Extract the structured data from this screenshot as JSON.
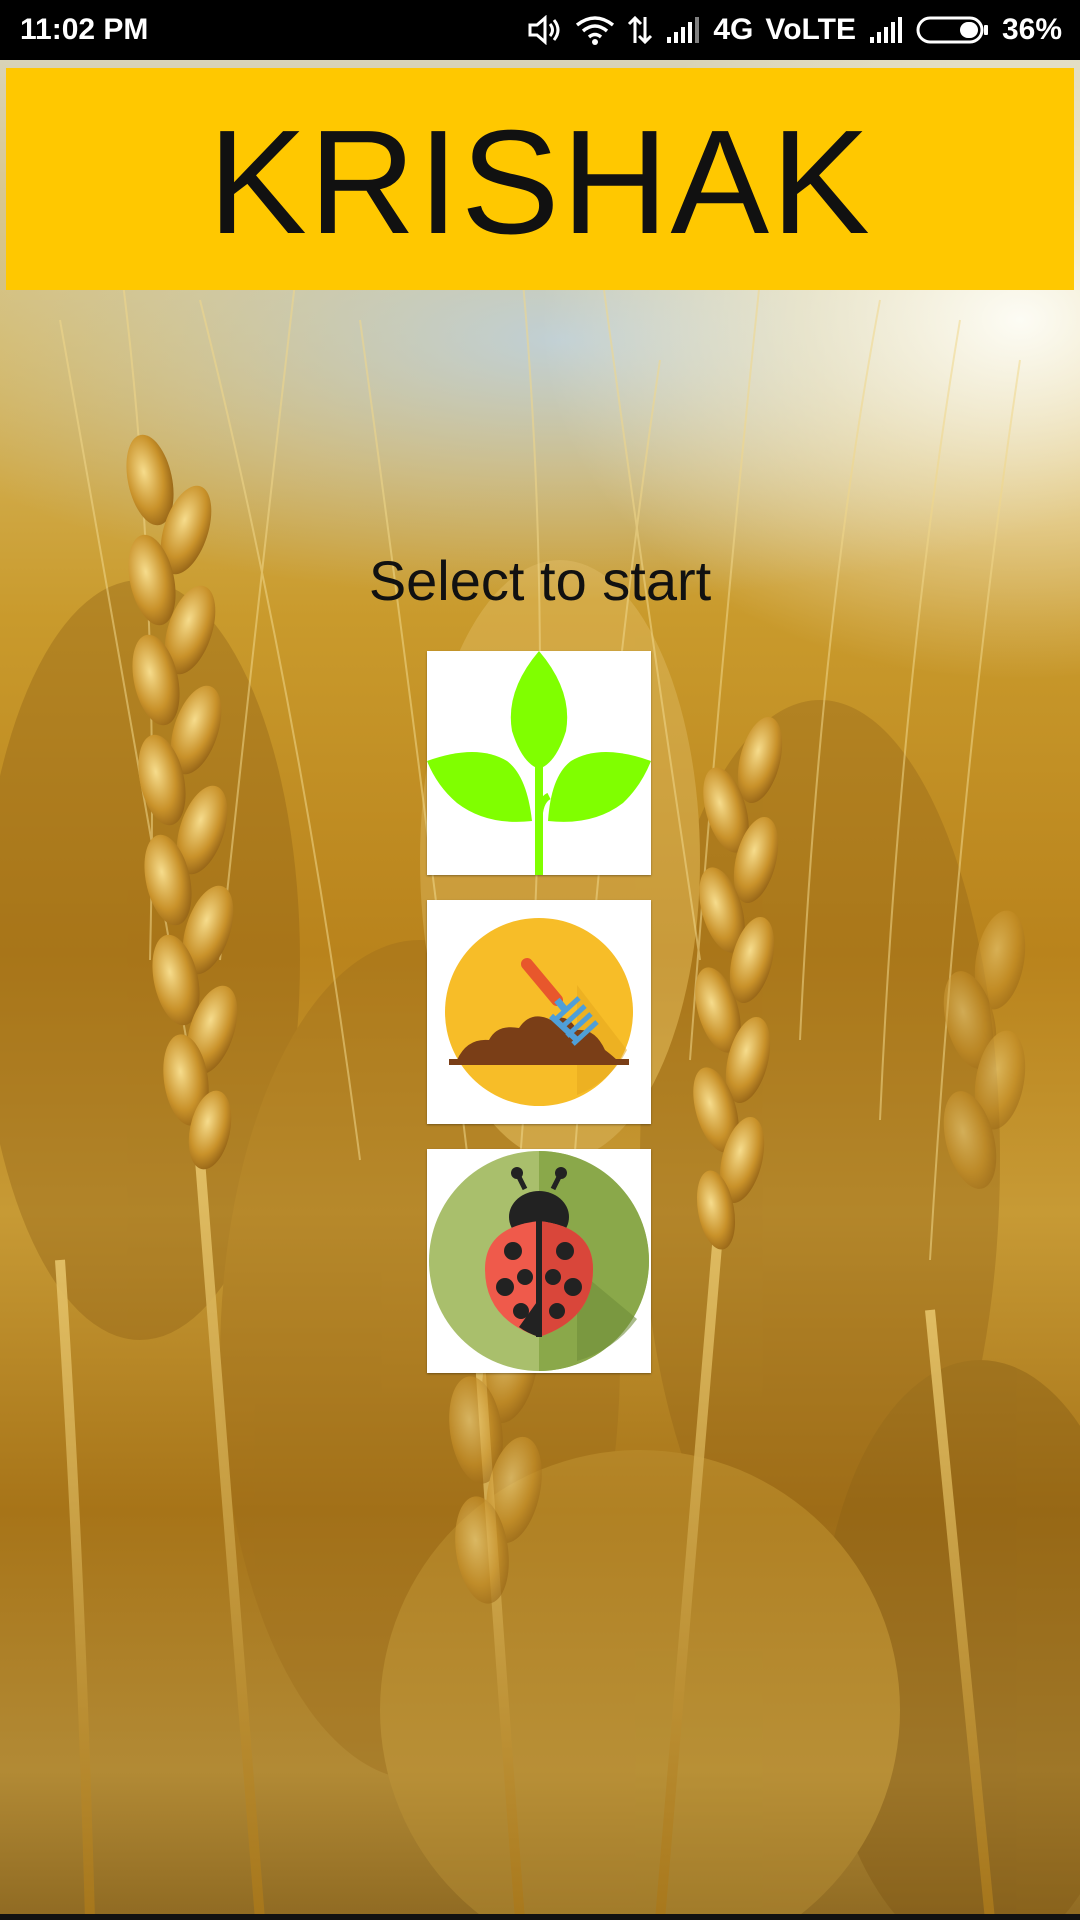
{
  "status_bar": {
    "time": "11:02 PM",
    "network": "4G",
    "volte": "VoLTE",
    "battery": "36%",
    "icons": [
      "volume-icon",
      "wifi-icon",
      "data-arrows-icon",
      "signal-icon",
      "signal-icon",
      "battery-icon"
    ]
  },
  "app_bar": {
    "title": "KRISHAK",
    "color": "#ffc800"
  },
  "main": {
    "prompt": "Select to start",
    "options": [
      {
        "icon": "plant-sprout-icon"
      },
      {
        "icon": "soil-rake-icon"
      },
      {
        "icon": "ladybug-pest-icon"
      }
    ]
  },
  "colors": {
    "app_bar": "#ffc800",
    "leaf_green": "#80ff00",
    "soil_circle": "#f7bd28",
    "pest_circle": "#a9bf6c",
    "ladybug_red": "#ef5a4b"
  }
}
